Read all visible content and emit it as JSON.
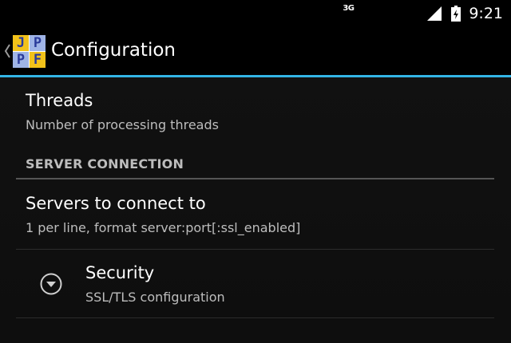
{
  "status_bar": {
    "network_type": "3G",
    "time": "9:21",
    "icons": [
      "signal-icon",
      "battery-icon"
    ]
  },
  "action_bar": {
    "title": "Configuration",
    "logo": [
      "J",
      "P",
      "P",
      "F"
    ],
    "up_icon": "chevron-left-icon",
    "accent_color": "#33b5e5"
  },
  "preferences": {
    "threads": {
      "title": "Threads",
      "summary": "Number of processing threads"
    },
    "server_connection": {
      "header": "SERVER CONNECTION",
      "servers": {
        "title": "Servers to connect to",
        "summary": "1 per line, format server:port[:ssl_enabled]"
      },
      "security": {
        "icon": "expand-down-icon",
        "title": "Security",
        "summary": "SSL/TLS configuration"
      }
    }
  }
}
